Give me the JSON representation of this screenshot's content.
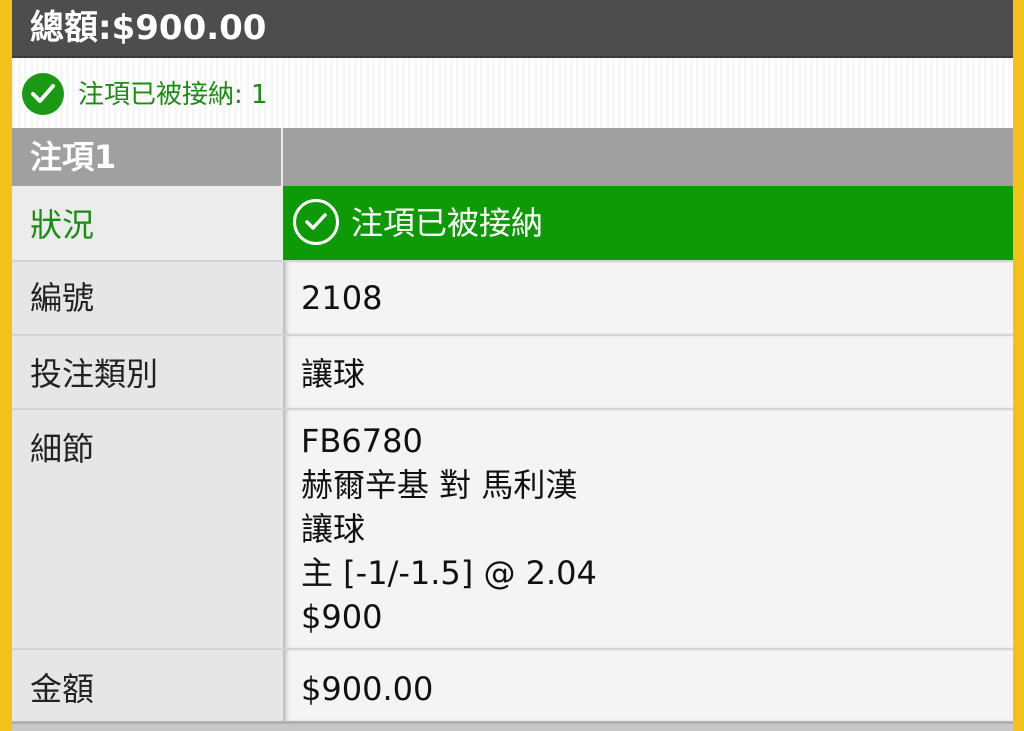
{
  "header": {
    "total_label": "總額:$900.00"
  },
  "notice": {
    "text": "注項已被接納: 1",
    "icon": "check-circle-icon",
    "color": "#1a8c12"
  },
  "section": {
    "title": "注項1"
  },
  "rows": {
    "status": {
      "label": "狀況",
      "value": "注項已被接納",
      "color": "#0e9a06",
      "icon": "check-circle-icon"
    },
    "id": {
      "label": "編號",
      "value": "2108"
    },
    "bet_type": {
      "label": "投注類別",
      "value": "讓球"
    },
    "details": {
      "label": "細節",
      "lines": [
        "FB6780",
        "赫爾辛基 對 馬利漢",
        "讓球",
        "主 [-1/-1.5] @ 2.04",
        "$900"
      ]
    },
    "amount": {
      "label": "金額",
      "value": "$900.00"
    }
  },
  "colors": {
    "accent_yellow": "#f2c21a",
    "header_dark": "#4d4d4d",
    "section_gray": "#a0a0a0",
    "success_green": "#0e9a06"
  }
}
